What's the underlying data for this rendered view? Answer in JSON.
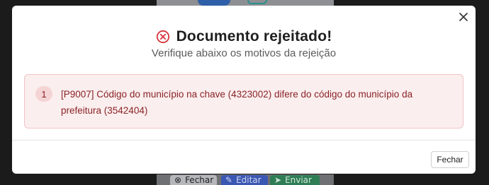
{
  "modal": {
    "title": "Documento rejeitado!",
    "subtitle": "Verifique abaixo os motivos da rejeição",
    "errors": [
      {
        "number": "1",
        "message": "[P9007] Código do município na chave (4323002) difere do código do município da prefeitura (3542404)"
      }
    ],
    "close_label": "Fechar",
    "status_color": "#d9343c"
  },
  "background": {
    "buttons": {
      "close": "Fechar",
      "edit": "Editar",
      "send": "Enviar"
    }
  }
}
